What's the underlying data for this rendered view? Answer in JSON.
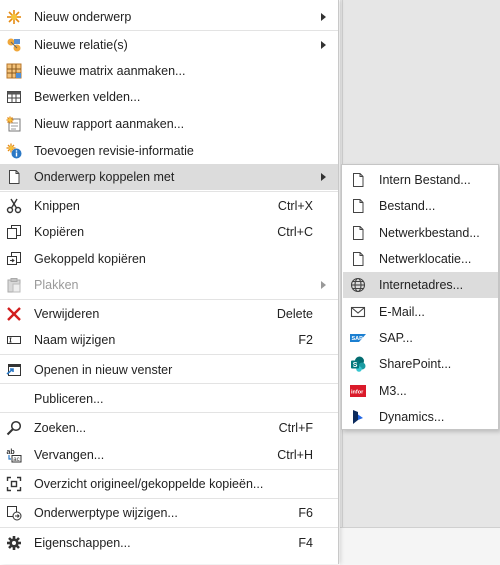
{
  "menu": {
    "items": [
      {
        "label": "Nieuw onderwerp",
        "icon": "sun-icon",
        "submenu": true
      },
      {
        "label": "Nieuwe relatie(s)",
        "icon": "relation-icon",
        "submenu": true
      },
      {
        "label": "Nieuwe matrix aanmaken...",
        "icon": "matrix-icon"
      },
      {
        "label": "Bewerken velden...",
        "icon": "table-icon"
      },
      {
        "label": "Nieuw rapport aanmaken...",
        "icon": "report-icon"
      },
      {
        "label": "Toevoegen revisie-informatie",
        "icon": "revision-info-icon"
      },
      {
        "label": "Onderwerp koppelen met",
        "icon": "document-icon",
        "submenu": true,
        "highlighted": true
      },
      {
        "label": "Knippen",
        "icon": "scissors-icon",
        "shortcut": "Ctrl+X"
      },
      {
        "label": "Kopiëren",
        "icon": "copy-icon",
        "shortcut": "Ctrl+C"
      },
      {
        "label": "Gekoppeld kopiëren",
        "icon": "linked-copy-icon"
      },
      {
        "label": "Plakken",
        "icon": "paste-icon",
        "submenu": true,
        "disabled": true
      },
      {
        "label": "Verwijderen",
        "icon": "delete-x-icon",
        "shortcut": "Delete"
      },
      {
        "label": "Naam wijzigen",
        "icon": "rename-icon",
        "shortcut": "F2"
      },
      {
        "label": "Openen in nieuw venster",
        "icon": "new-window-icon"
      },
      {
        "label": "Publiceren...",
        "icon": ""
      },
      {
        "label": "Zoeken...",
        "icon": "search-icon",
        "shortcut": "Ctrl+F"
      },
      {
        "label": "Vervangen...",
        "icon": "replace-icon",
        "shortcut": "Ctrl+H"
      },
      {
        "label": "Overzicht origineel/gekoppelde kopieën...",
        "icon": "overview-icon"
      },
      {
        "label": "Onderwerptype wijzigen...",
        "icon": "change-type-icon",
        "shortcut": "F6"
      },
      {
        "label": "Eigenschappen...",
        "icon": "gear-icon",
        "shortcut": "F4"
      }
    ]
  },
  "submenu": {
    "items": [
      {
        "label": "Intern Bestand...",
        "icon": "document-icon"
      },
      {
        "label": "Bestand...",
        "icon": "document-icon"
      },
      {
        "label": "Netwerkbestand...",
        "icon": "document-icon"
      },
      {
        "label": "Netwerklocatie...",
        "icon": "document-icon"
      },
      {
        "label": "Internetadres...",
        "icon": "globe-icon",
        "highlighted": true
      },
      {
        "label": "E-Mail...",
        "icon": "mail-icon"
      },
      {
        "label": "SAP...",
        "icon": "sap-icon"
      },
      {
        "label": "SharePoint...",
        "icon": "sharepoint-icon"
      },
      {
        "label": "M3...",
        "icon": "infor-icon"
      },
      {
        "label": "Dynamics...",
        "icon": "dynamics-icon"
      }
    ]
  }
}
